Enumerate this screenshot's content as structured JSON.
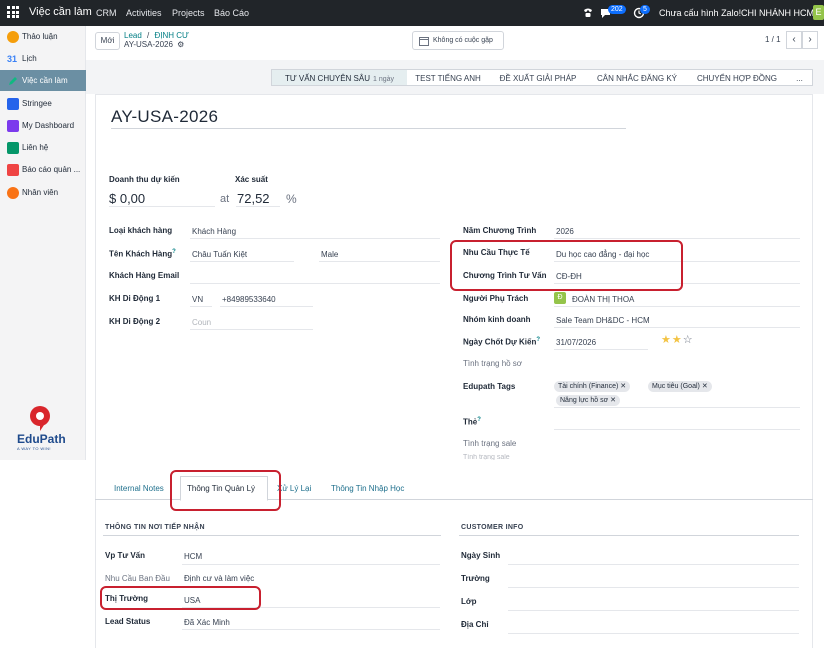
{
  "topbar": {
    "app_name": "Việc cần làm",
    "menus": [
      "CRM",
      "Activities",
      "Projects",
      "Báo Cáo"
    ],
    "chat_count": "202",
    "activity_count": "5",
    "zalo_text": "Chưa cấu hình Zalo!",
    "company": "CHI NHÁNH HCM",
    "user_initial": "E"
  },
  "sidebar": {
    "items": [
      {
        "label": "Thảo luận",
        "icon": "chat-bubble-icon",
        "color": "#f59e0b"
      },
      {
        "label": "Lịch",
        "icon": "calendar-icon",
        "color": "#3b82f6"
      },
      {
        "label": "Việc cần làm",
        "icon": "pencil-icon",
        "color": "#10b981"
      },
      {
        "label": "Stringee",
        "icon": "stringee-icon",
        "color": "#2563eb"
      },
      {
        "label": "My Dashboard",
        "icon": "dashboard-icon",
        "color": "#7c3aed"
      },
      {
        "label": "Liên hệ",
        "icon": "contact-icon",
        "color": "#059669"
      },
      {
        "label": "Báo cáo quản ...",
        "icon": "report-icon",
        "color": "#ef4444"
      },
      {
        "label": "Nhân viên",
        "icon": "employees-icon",
        "color": "#f97316"
      }
    ],
    "logo_text": "EduPath",
    "logo_tagline": "A WAY TO WIN!"
  },
  "control": {
    "new_label": "Mới",
    "crumb_parent": "Lead",
    "crumb_sep": "/",
    "crumb_stage": "ĐỊNH CƯ",
    "crumb_record": "AY-USA-2026",
    "meeting_label": "Không có cuộc gặp",
    "pager": "1 / 1"
  },
  "stages": [
    {
      "label": "TƯ VẤN CHUYÊN SÂU",
      "count": "1 ngày"
    },
    {
      "label": "TEST TIẾNG ANH",
      "count": ""
    },
    {
      "label": "ĐỀ XUẤT GIẢI PHÁP",
      "count": ""
    },
    {
      "label": "CÂN NHẮC ĐĂNG KÝ",
      "count": ""
    },
    {
      "label": "CHUYỂN HỢP ĐỒNG",
      "count": ""
    },
    {
      "label": "...",
      "count": ""
    }
  ],
  "record": {
    "title": "AY-USA-2026",
    "revenue_label": "Doanh thu dự kiến",
    "revenue": "$ 0,00",
    "at": "at",
    "prob_label": "Xác suất",
    "prob": "72,52",
    "percent": "%"
  },
  "left_fields": {
    "customer_type_label": "Loại khách hàng",
    "customer_type": "Khách Hàng",
    "customer_name_label": "Tên Khách Hàng",
    "customer_name_sup": "?",
    "customer_name": "Châu Tuấn Kiệt",
    "gender": "Male",
    "email_label": "Khách Hàng Email",
    "phone1_label": "KH Di Động 1",
    "phone1_country": "VN",
    "phone1": "+84989533640",
    "phone2_label": "KH Di Động 2",
    "phone2_placeholder": "Coun"
  },
  "right_fields": {
    "year_label": "Năm Chương Trình",
    "year": "2026",
    "need_label": "Nhu Cầu Thực Tế",
    "need": "Du học cao đẳng - đại học",
    "program_label": "Chương Trình Tư Vấn",
    "program": "CĐ-ĐH",
    "owner_label": "Người Phụ Trách",
    "owner_initial": "Đ",
    "owner": "ĐOÀN THỊ THOA",
    "team_label": "Nhóm kinh doanh",
    "team": "Sale Team DH&DC - HCM",
    "close_label": "Ngày Chốt Dự Kiến",
    "close_sup": "?",
    "close_date": "31/07/2026",
    "stars": 2,
    "stars_max": 3,
    "doc_status_label": "Tình trạng hồ sơ",
    "tags_label": "Edupath Tags",
    "tags": [
      "Tài chính (Finance)",
      "Mục tiêu (Goal)",
      "Năng lực hồ sơ"
    ],
    "the_label": "Thẻ",
    "the_sup": "?",
    "sale_status_label": "Tình trạng sale",
    "extra_label": "Tình trạng sale"
  },
  "tabs": [
    "Internal Notes",
    "Thông Tin Quản Lý",
    "Xử Lý Lại",
    "Thông Tin Nhập Học"
  ],
  "intake": {
    "section_title": "THÔNG TIN NƠI TIẾP NHẬN",
    "advisor_label": "Vp Tư Vấn",
    "advisor": "HCM",
    "initial_need_label": "Nhu Cầu Ban Đầu",
    "initial_need": "Định cư và làm việc",
    "market_label": "Thị Trường",
    "market": "USA",
    "lead_status_label": "Lead Status",
    "lead_status": "Đã Xác Minh"
  },
  "customer_info": {
    "section_title": "CUSTOMER INFO",
    "birthday_label": "Ngày Sinh",
    "school_label": "Trường",
    "class_label": "Lớp",
    "address_label": "Địa Chỉ"
  },
  "colors": {
    "topbar": "#212529",
    "accent": "#017e84",
    "highlight": "#c8202f",
    "sidebar_active": "#6b8fa3"
  }
}
